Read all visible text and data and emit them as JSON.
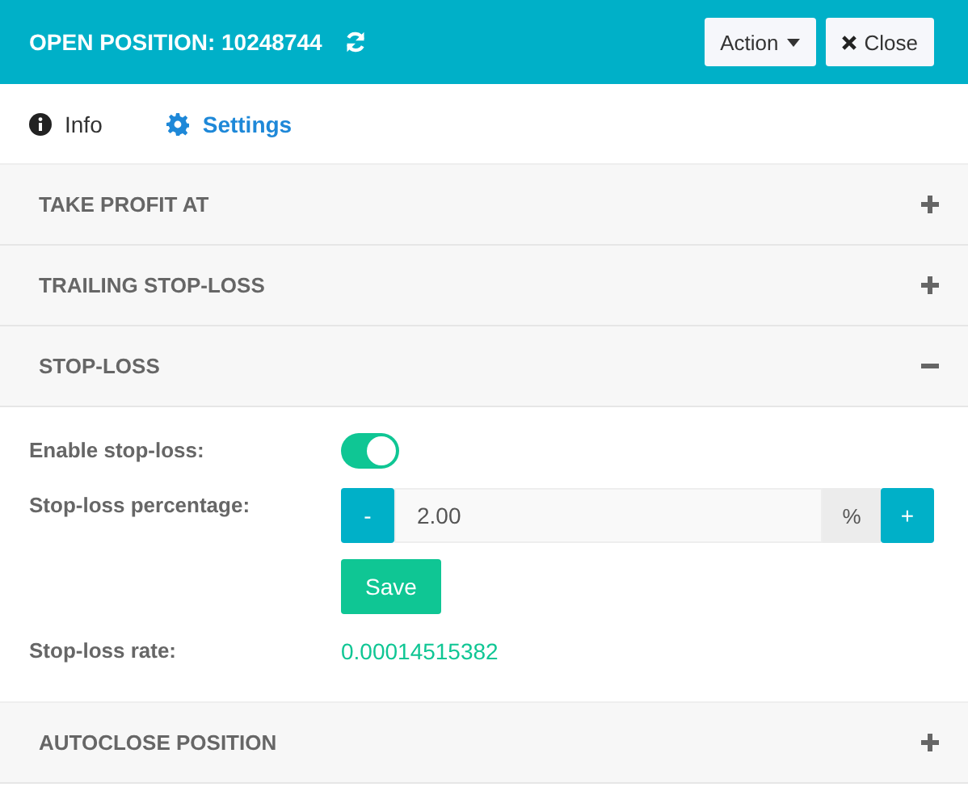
{
  "header": {
    "title": "OPEN POSITION: 10248744",
    "buttons": [
      {
        "label": "Action",
        "kind": "dropdown"
      },
      {
        "label": "Close",
        "kind": "close"
      }
    ]
  },
  "tabs": [
    {
      "label": "Info",
      "kind": "info",
      "selected": false
    },
    {
      "label": "Settings",
      "kind": "settings",
      "selected": true
    }
  ],
  "sections": [
    {
      "title": "TAKE PROFIT AT",
      "expanded": false
    },
    {
      "title": "TRAILING STOP-LOSS",
      "expanded": false
    },
    {
      "title": "STOP-LOSS",
      "expanded": true,
      "fields": [
        {
          "kind": "toggle",
          "label": "Enable stop-loss:",
          "on": true
        },
        {
          "kind": "stepper",
          "label": "Stop-loss percentage:",
          "value": "2.00",
          "unit": "%",
          "minus": "-",
          "plus": "+",
          "button": "Save"
        },
        {
          "kind": "value",
          "label": "Stop-loss rate:",
          "value": "0.00014515382"
        }
      ]
    },
    {
      "title": "AUTOCLOSE POSITION",
      "expanded": false
    }
  ]
}
